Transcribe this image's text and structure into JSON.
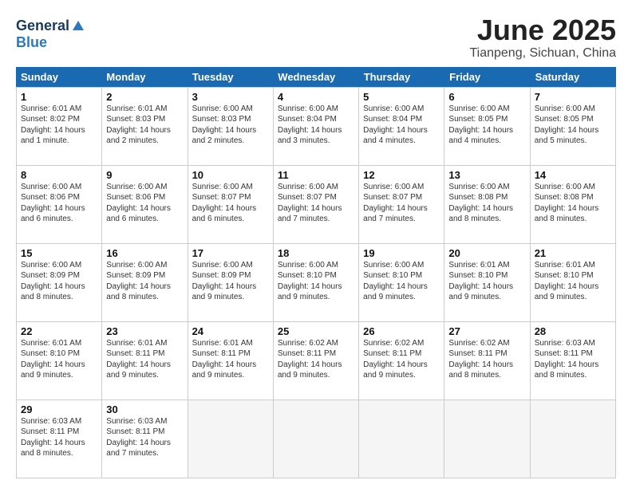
{
  "logo": {
    "general": "General",
    "blue": "Blue"
  },
  "title": "June 2025",
  "subtitle": "Tianpeng, Sichuan, China",
  "header_days": [
    "Sunday",
    "Monday",
    "Tuesday",
    "Wednesday",
    "Thursday",
    "Friday",
    "Saturday"
  ],
  "weeks": [
    [
      {
        "day": "1",
        "lines": [
          "Sunrise: 6:01 AM",
          "Sunset: 8:02 PM",
          "Daylight: 14 hours",
          "and 1 minute."
        ]
      },
      {
        "day": "2",
        "lines": [
          "Sunrise: 6:01 AM",
          "Sunset: 8:03 PM",
          "Daylight: 14 hours",
          "and 2 minutes."
        ]
      },
      {
        "day": "3",
        "lines": [
          "Sunrise: 6:00 AM",
          "Sunset: 8:03 PM",
          "Daylight: 14 hours",
          "and 2 minutes."
        ]
      },
      {
        "day": "4",
        "lines": [
          "Sunrise: 6:00 AM",
          "Sunset: 8:04 PM",
          "Daylight: 14 hours",
          "and 3 minutes."
        ]
      },
      {
        "day": "5",
        "lines": [
          "Sunrise: 6:00 AM",
          "Sunset: 8:04 PM",
          "Daylight: 14 hours",
          "and 4 minutes."
        ]
      },
      {
        "day": "6",
        "lines": [
          "Sunrise: 6:00 AM",
          "Sunset: 8:05 PM",
          "Daylight: 14 hours",
          "and 4 minutes."
        ]
      },
      {
        "day": "7",
        "lines": [
          "Sunrise: 6:00 AM",
          "Sunset: 8:05 PM",
          "Daylight: 14 hours",
          "and 5 minutes."
        ]
      }
    ],
    [
      {
        "day": "8",
        "lines": [
          "Sunrise: 6:00 AM",
          "Sunset: 8:06 PM",
          "Daylight: 14 hours",
          "and 6 minutes."
        ]
      },
      {
        "day": "9",
        "lines": [
          "Sunrise: 6:00 AM",
          "Sunset: 8:06 PM",
          "Daylight: 14 hours",
          "and 6 minutes."
        ]
      },
      {
        "day": "10",
        "lines": [
          "Sunrise: 6:00 AM",
          "Sunset: 8:07 PM",
          "Daylight: 14 hours",
          "and 6 minutes."
        ]
      },
      {
        "day": "11",
        "lines": [
          "Sunrise: 6:00 AM",
          "Sunset: 8:07 PM",
          "Daylight: 14 hours",
          "and 7 minutes."
        ]
      },
      {
        "day": "12",
        "lines": [
          "Sunrise: 6:00 AM",
          "Sunset: 8:07 PM",
          "Daylight: 14 hours",
          "and 7 minutes."
        ]
      },
      {
        "day": "13",
        "lines": [
          "Sunrise: 6:00 AM",
          "Sunset: 8:08 PM",
          "Daylight: 14 hours",
          "and 8 minutes."
        ]
      },
      {
        "day": "14",
        "lines": [
          "Sunrise: 6:00 AM",
          "Sunset: 8:08 PM",
          "Daylight: 14 hours",
          "and 8 minutes."
        ]
      }
    ],
    [
      {
        "day": "15",
        "lines": [
          "Sunrise: 6:00 AM",
          "Sunset: 8:09 PM",
          "Daylight: 14 hours",
          "and 8 minutes."
        ]
      },
      {
        "day": "16",
        "lines": [
          "Sunrise: 6:00 AM",
          "Sunset: 8:09 PM",
          "Daylight: 14 hours",
          "and 8 minutes."
        ]
      },
      {
        "day": "17",
        "lines": [
          "Sunrise: 6:00 AM",
          "Sunset: 8:09 PM",
          "Daylight: 14 hours",
          "and 9 minutes."
        ]
      },
      {
        "day": "18",
        "lines": [
          "Sunrise: 6:00 AM",
          "Sunset: 8:10 PM",
          "Daylight: 14 hours",
          "and 9 minutes."
        ]
      },
      {
        "day": "19",
        "lines": [
          "Sunrise: 6:00 AM",
          "Sunset: 8:10 PM",
          "Daylight: 14 hours",
          "and 9 minutes."
        ]
      },
      {
        "day": "20",
        "lines": [
          "Sunrise: 6:01 AM",
          "Sunset: 8:10 PM",
          "Daylight: 14 hours",
          "and 9 minutes."
        ]
      },
      {
        "day": "21",
        "lines": [
          "Sunrise: 6:01 AM",
          "Sunset: 8:10 PM",
          "Daylight: 14 hours",
          "and 9 minutes."
        ]
      }
    ],
    [
      {
        "day": "22",
        "lines": [
          "Sunrise: 6:01 AM",
          "Sunset: 8:10 PM",
          "Daylight: 14 hours",
          "and 9 minutes."
        ]
      },
      {
        "day": "23",
        "lines": [
          "Sunrise: 6:01 AM",
          "Sunset: 8:11 PM",
          "Daylight: 14 hours",
          "and 9 minutes."
        ]
      },
      {
        "day": "24",
        "lines": [
          "Sunrise: 6:01 AM",
          "Sunset: 8:11 PM",
          "Daylight: 14 hours",
          "and 9 minutes."
        ]
      },
      {
        "day": "25",
        "lines": [
          "Sunrise: 6:02 AM",
          "Sunset: 8:11 PM",
          "Daylight: 14 hours",
          "and 9 minutes."
        ]
      },
      {
        "day": "26",
        "lines": [
          "Sunrise: 6:02 AM",
          "Sunset: 8:11 PM",
          "Daylight: 14 hours",
          "and 9 minutes."
        ]
      },
      {
        "day": "27",
        "lines": [
          "Sunrise: 6:02 AM",
          "Sunset: 8:11 PM",
          "Daylight: 14 hours",
          "and 8 minutes."
        ]
      },
      {
        "day": "28",
        "lines": [
          "Sunrise: 6:03 AM",
          "Sunset: 8:11 PM",
          "Daylight: 14 hours",
          "and 8 minutes."
        ]
      }
    ],
    [
      {
        "day": "29",
        "lines": [
          "Sunrise: 6:03 AM",
          "Sunset: 8:11 PM",
          "Daylight: 14 hours",
          "and 8 minutes."
        ]
      },
      {
        "day": "30",
        "lines": [
          "Sunrise: 6:03 AM",
          "Sunset: 8:11 PM",
          "Daylight: 14 hours",
          "and 7 minutes."
        ]
      },
      {
        "day": "",
        "lines": []
      },
      {
        "day": "",
        "lines": []
      },
      {
        "day": "",
        "lines": []
      },
      {
        "day": "",
        "lines": []
      },
      {
        "day": "",
        "lines": []
      }
    ]
  ]
}
